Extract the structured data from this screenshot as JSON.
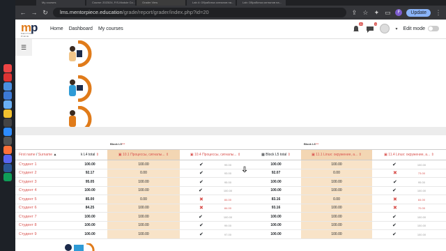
{
  "browser": {
    "tabs": [
      "My courses",
      "Course: 2023/24, F/S-Module Co...",
      "Grader View",
      "Lab 4: Обработка сигналов на...",
      "Lab: Обработка сигналов на..."
    ],
    "url_host": "lms.mentorpiece.education",
    "url_path": "/grade/report/grader/index.php?id=20",
    "update_label": "Update",
    "profile_initial": "F"
  },
  "nav": {
    "logo_sub": "MENTOR PIECE",
    "links": [
      "Home",
      "Dashboard",
      "My courses"
    ],
    "notif_badge": "21",
    "msg_badge": "1",
    "edit_mode_label": "Edit mode"
  },
  "grader": {
    "category_l5": "Block L5",
    "category_l6": "Block L6",
    "name_header_first": "First name",
    "name_header_sep": " / ",
    "name_header_last": "Surname",
    "columns": [
      "k L4 total",
      "10.1 Процессы, сигналы...",
      "10.4 Процессы, сигналы...",
      "Block L5 total",
      "11.1 Linux: окружение, а...",
      "11.4 Linux: окружение, а..."
    ],
    "rows": [
      {
        "name": "Студент 1",
        "l4": "100.00",
        "c1": "100.00",
        "c2": "check",
        "c2v": "99.00",
        "l5": "100.00",
        "c3": "100.00",
        "c4": "check",
        "c4v": "100.00"
      },
      {
        "name": "Студент 2",
        "l4": "92.17",
        "c1": "0.00",
        "c2": "check",
        "c2v": "93.00",
        "l5": "92.07",
        "c3": "0.00",
        "c4": "cross",
        "c4v": "73.00"
      },
      {
        "name": "Студент 3",
        "l4": "95.05",
        "c1": "100.00",
        "c2": "check",
        "c2v": "95.00",
        "l5": "100.00",
        "c3": "100.00",
        "c4": "check",
        "c4v": "95.00"
      },
      {
        "name": "Студент 4",
        "l4": "100.00",
        "c1": "100.00",
        "c2": "check",
        "c2v": "100.00",
        "l5": "100.00",
        "c3": "100.00",
        "c4": "check",
        "c4v": "100.00"
      },
      {
        "name": "Студент 5",
        "l4": "85.00",
        "c1": "0.00",
        "c2": "cross",
        "c2v": "84.00",
        "l5": "83.16",
        "c3": "0.00",
        "c4": "cross",
        "c4v": "84.00"
      },
      {
        "name": "Студент 6",
        "l4": "84.25",
        "c1": "100.00",
        "c2": "cross",
        "c2v": "84.00",
        "l5": "93.16",
        "c3": "100.00",
        "c4": "cross",
        "c4v": "70.00"
      },
      {
        "name": "Студент 7",
        "l4": "100.00",
        "c1": "100.00",
        "c2": "check",
        "c2v": "100.00",
        "l5": "100.00",
        "c3": "100.00",
        "c4": "check",
        "c4v": "100.00"
      },
      {
        "name": "Студент 8",
        "l4": "100.00",
        "c1": "100.00",
        "c2": "check",
        "c2v": "99.00",
        "l5": "100.00",
        "c3": "100.00",
        "c4": "check",
        "c4v": "100.00"
      },
      {
        "name": "Студент 9",
        "l4": "100.00",
        "c1": "100.00",
        "c2": "check",
        "c2v": "97.00",
        "l5": "100.00",
        "c3": "100.00",
        "c4": "check",
        "c4v": "100.00"
      }
    ]
  },
  "colors": {
    "accent_orange": "#e07b1a",
    "tan_cell": "#f8e3c8",
    "red": "#d9534f",
    "navy": "#1b2a4a"
  }
}
